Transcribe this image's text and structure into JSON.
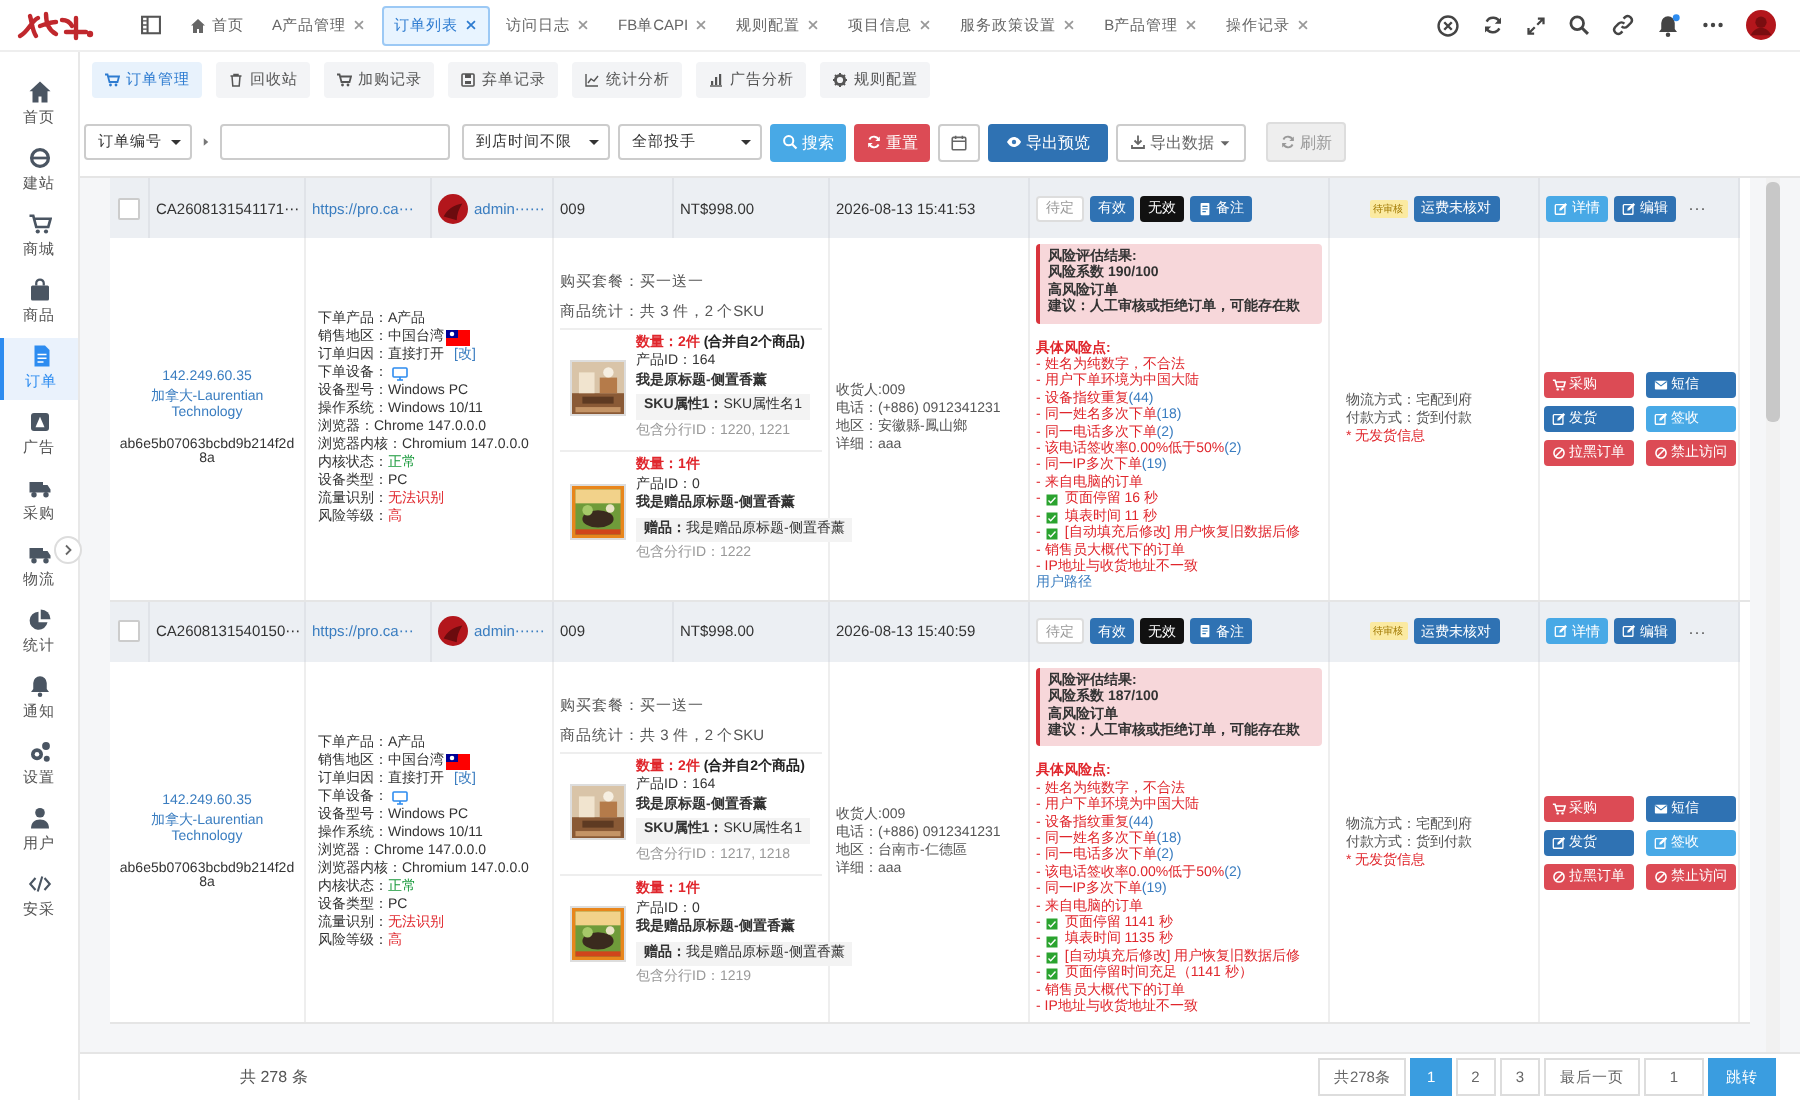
{
  "sidebar": {
    "items": [
      {
        "label": "首页",
        "selected": false
      },
      {
        "label": "建站",
        "selected": false
      },
      {
        "label": "商城",
        "selected": false
      },
      {
        "label": "商品",
        "selected": false
      },
      {
        "label": "订单",
        "selected": true
      },
      {
        "label": "广告",
        "selected": false
      },
      {
        "label": "采购",
        "selected": false
      },
      {
        "label": "物流",
        "selected": false
      },
      {
        "label": "统计",
        "selected": false
      },
      {
        "label": "通知",
        "selected": false
      },
      {
        "label": "设置",
        "selected": false
      },
      {
        "label": "用户",
        "selected": false
      },
      {
        "label": "安采",
        "selected": false
      }
    ]
  },
  "tabs": [
    {
      "label": "首页",
      "kind": "home",
      "selected": false
    },
    {
      "label": "A产品管理",
      "kind": "page",
      "selected": false
    },
    {
      "label": "订单列表",
      "kind": "page",
      "selected": true
    },
    {
      "label": "访问日志",
      "kind": "page",
      "selected": false
    },
    {
      "label": "FB单CAPI",
      "kind": "page",
      "selected": false
    },
    {
      "label": "规则配置",
      "kind": "page",
      "selected": false
    },
    {
      "label": "项目信息",
      "kind": "page",
      "selected": false
    },
    {
      "label": "服务政策设置",
      "kind": "page",
      "selected": false
    },
    {
      "label": "B产品管理",
      "kind": "page",
      "selected": false
    },
    {
      "label": "操作记录",
      "kind": "page",
      "selected": false
    }
  ],
  "toolbar": [
    {
      "label": "订单管理",
      "selected": true
    },
    {
      "label": "回收站",
      "selected": false
    },
    {
      "label": "加购记录",
      "selected": false
    },
    {
      "label": "弃单记录",
      "selected": false
    },
    {
      "label": "统计分析",
      "selected": false
    },
    {
      "label": "广告分析",
      "selected": false
    },
    {
      "label": "规则配置",
      "selected": false
    }
  ],
  "filters": {
    "field_select": "订单编号",
    "time_select": "到店时间不限",
    "pitcher_select": "全部投手",
    "search_button": "搜索",
    "reset_button": "重置",
    "preview_button": "导出预览",
    "export_button": "导出数据",
    "refresh_button": "刷新"
  },
  "orders": [
    {
      "checked": false,
      "order_no": "CA2608131541171⋯",
      "link": "https://pro.ca⋯",
      "user": "admin⋯⋯",
      "code": "009",
      "price": "NT$998.00",
      "time": "2026-08-13 15:41:53",
      "status_buttons": [
        {
          "label": "待定",
          "kind": "pending"
        },
        {
          "label": "有效",
          "kind": "valid"
        },
        {
          "label": "无效",
          "kind": "invalid"
        },
        {
          "label": "备注",
          "kind": "note"
        }
      ],
      "badge": "待审核",
      "freight": "运费未核对",
      "row_actions": [
        {
          "label": "详情",
          "kind": "info"
        },
        {
          "label": "编辑",
          "kind": "primary"
        }
      ],
      "more": "···",
      "ip": "142.249.60.35",
      "isp": "加拿大-Laurentian Technology",
      "fingerprint": "ab6e5b07063bcbd9b214f2d8a",
      "info": [
        {
          "kind": "text",
          "label": "下单产品：",
          "value": "A产品"
        },
        {
          "kind": "flag",
          "label": "销售地区：",
          "value": "中国台湾"
        },
        {
          "kind": "link",
          "label": "订单归因：",
          "value": "直接打开",
          "link": "[改]"
        },
        {
          "kind": "device",
          "label": "下单设备："
        },
        {
          "kind": "text",
          "label": "设备型号：",
          "value": "Windows PC"
        },
        {
          "kind": "text",
          "label": "操作系统：",
          "value": "Windows 10/11"
        },
        {
          "kind": "text",
          "label": "浏览器：",
          "value": "Chrome 147.0.0.0"
        },
        {
          "kind": "text",
          "label": "浏览器内核：",
          "value": "Chromium 147.0.0.0"
        },
        {
          "kind": "good",
          "label": "内核状态：",
          "value": "正常"
        },
        {
          "kind": "text",
          "label": "设备类型：",
          "value": "PC"
        },
        {
          "kind": "bad",
          "label": "流量识别：",
          "value": "无法识别"
        },
        {
          "kind": "bad",
          "label": "风险等级：",
          "value": "高"
        }
      ],
      "package": "购买套餐：买一送一",
      "stats": "商品统计：共 3 件，2 个SKU",
      "items": [
        {
          "qty_label": "数量：",
          "qty": "2件",
          "qty_note": "(合并自2个商品)",
          "product_id": "产品ID：164",
          "title": "我是原标题-侧置香薰",
          "attr_label": "SKU属性1：",
          "attr_value": "SKU属性名1",
          "line_ids": "包含分行ID：1220, 1221"
        },
        {
          "qty_label": "数量：",
          "qty": "1件",
          "product_id": "产品ID：0",
          "title": "我是赠品原标题-侧置香薰",
          "attr_label": "赠品：",
          "attr_value": "我是赠品原标题-侧置香薰",
          "line_ids": "包含分行ID：1222"
        }
      ],
      "receiver": [
        "收货人:009",
        "电话：(+886) 0912341231",
        "地区：安徽縣-鳳山鄉",
        "详细：aaa"
      ],
      "risk_summary": [
        "风险评估结果:",
        "风险系数 190/100",
        "高风险订单",
        "建议：人工审核或拒绝订单，可能存在欺"
      ],
      "risk_title": "具体风险点:",
      "risks": [
        {
          "kind": "plain",
          "text": "- 姓名为纯数字，不合法"
        },
        {
          "kind": "plain",
          "text": "- 用户下单环境为中国大陆"
        },
        {
          "kind": "count",
          "text": "- 设备指纹重复",
          "count": "(44)"
        },
        {
          "kind": "count",
          "text": "- 同一姓名多次下单",
          "count": "(18)"
        },
        {
          "kind": "count",
          "text": "- 同一电话多次下单",
          "count": "(2)"
        },
        {
          "kind": "count",
          "text": "- 该电话签收率0.00%低于50%",
          "count": "(2)"
        },
        {
          "kind": "count",
          "text": "- 同一IP多次下单",
          "count": "(19)"
        },
        {
          "kind": "plain",
          "text": "- 来自电脑的订单"
        },
        {
          "kind": "check",
          "dash": "-",
          "text": "页面停留 16 秒"
        },
        {
          "kind": "check",
          "dash": "-",
          "text": "填表时间 11 秒"
        },
        {
          "kind": "check",
          "dash": "-",
          "text": "[自动填充后修改] 用户恢复旧数据后修"
        },
        {
          "kind": "plain",
          "text": "- 销售员大概代下的订单"
        },
        {
          "kind": "plain",
          "text": "- IP地址与收货地址不一致"
        }
      ],
      "path_link": "用户路径",
      "shipping": [
        "物流方式：宅配到府",
        "付款方式：货到付款"
      ],
      "shipping_warning": "* 无发货信息",
      "actions": [
        {
          "label": "采购",
          "kind": "danger"
        },
        {
          "label": "短信",
          "kind": "primary"
        },
        {
          "label": "发货",
          "kind": "primary"
        },
        {
          "label": "签收",
          "kind": "info"
        },
        {
          "label": "拉黑订单",
          "kind": "danger"
        },
        {
          "label": "禁止访问",
          "kind": "danger"
        }
      ]
    },
    {
      "checked": false,
      "order_no": "CA2608131540150⋯",
      "link": "https://pro.ca⋯",
      "user": "admin⋯⋯",
      "code": "009",
      "price": "NT$998.00",
      "time": "2026-08-13 15:40:59",
      "status_buttons": [
        {
          "label": "待定",
          "kind": "pending"
        },
        {
          "label": "有效",
          "kind": "valid"
        },
        {
          "label": "无效",
          "kind": "invalid"
        },
        {
          "label": "备注",
          "kind": "note"
        }
      ],
      "badge": "待审核",
      "freight": "运费未核对",
      "row_actions": [
        {
          "label": "详情",
          "kind": "info"
        },
        {
          "label": "编辑",
          "kind": "primary"
        }
      ],
      "more": "···",
      "ip": "142.249.60.35",
      "isp": "加拿大-Laurentian Technology",
      "fingerprint": "ab6e5b07063bcbd9b214f2d8a",
      "info": [
        {
          "kind": "text",
          "label": "下单产品：",
          "value": "A产品"
        },
        {
          "kind": "flag",
          "label": "销售地区：",
          "value": "中国台湾"
        },
        {
          "kind": "link",
          "label": "订单归因：",
          "value": "直接打开",
          "link": "[改]"
        },
        {
          "kind": "device",
          "label": "下单设备："
        },
        {
          "kind": "text",
          "label": "设备型号：",
          "value": "Windows PC"
        },
        {
          "kind": "text",
          "label": "操作系统：",
          "value": "Windows 10/11"
        },
        {
          "kind": "text",
          "label": "浏览器：",
          "value": "Chrome 147.0.0.0"
        },
        {
          "kind": "text",
          "label": "浏览器内核：",
          "value": "Chromium 147.0.0.0"
        },
        {
          "kind": "good",
          "label": "内核状态：",
          "value": "正常"
        },
        {
          "kind": "text",
          "label": "设备类型：",
          "value": "PC"
        },
        {
          "kind": "bad",
          "label": "流量识别：",
          "value": "无法识别"
        },
        {
          "kind": "bad",
          "label": "风险等级：",
          "value": "高"
        }
      ],
      "package": "购买套餐：买一送一",
      "stats": "商品统计：共 3 件，2 个SKU",
      "items": [
        {
          "qty_label": "数量：",
          "qty": "2件",
          "qty_note": "(合并自2个商品)",
          "product_id": "产品ID：164",
          "title": "我是原标题-侧置香薰",
          "attr_label": "SKU属性1：",
          "attr_value": "SKU属性名1",
          "line_ids": "包含分行ID：1217, 1218"
        },
        {
          "qty_label": "数量：",
          "qty": "1件",
          "product_id": "产品ID：0",
          "title": "我是赠品原标题-侧置香薰",
          "attr_label": "赠品：",
          "attr_value": "我是赠品原标题-侧置香薰",
          "line_ids": "包含分行ID：1219"
        }
      ],
      "receiver": [
        "收货人:009",
        "电话：(+886) 0912341231",
        "地区：台南市-仁德區",
        "详细：aaa"
      ],
      "risk_summary": [
        "风险评估结果:",
        "风险系数 187/100",
        "高风险订单",
        "建议：人工审核或拒绝订单，可能存在欺"
      ],
      "risk_title": "具体风险点:",
      "risks": [
        {
          "kind": "plain",
          "text": "- 姓名为纯数字，不合法"
        },
        {
          "kind": "plain",
          "text": "- 用户下单环境为中国大陆"
        },
        {
          "kind": "count",
          "text": "- 设备指纹重复",
          "count": "(44)"
        },
        {
          "kind": "count",
          "text": "- 同一姓名多次下单",
          "count": "(18)"
        },
        {
          "kind": "count",
          "text": "- 同一电话多次下单",
          "count": "(2)"
        },
        {
          "kind": "count",
          "text": "- 该电话签收率0.00%低于50%",
          "count": "(2)"
        },
        {
          "kind": "count",
          "text": "- 同一IP多次下单",
          "count": "(19)"
        },
        {
          "kind": "plain",
          "text": "- 来自电脑的订单"
        },
        {
          "kind": "check",
          "dash": "-",
          "text": "页面停留 1141 秒"
        },
        {
          "kind": "check",
          "dash": "-",
          "text": "填表时间 1135 秒"
        },
        {
          "kind": "check",
          "dash": "-",
          "text": "[自动填充后修改] 用户恢复旧数据后修"
        },
        {
          "kind": "check",
          "dash": "-",
          "text": "页面停留时间充足（1141 秒）"
        },
        {
          "kind": "plain",
          "text": "- 销售员大概代下的订单"
        },
        {
          "kind": "plain",
          "text": "- IP地址与收货地址不一致"
        }
      ],
      "shipping": [
        "物流方式：宅配到府",
        "付款方式：货到付款"
      ],
      "shipping_warning": "* 无发货信息",
      "actions": [
        {
          "label": "采购",
          "kind": "danger"
        },
        {
          "label": "短信",
          "kind": "primary"
        },
        {
          "label": "发货",
          "kind": "primary"
        },
        {
          "label": "签收",
          "kind": "info"
        },
        {
          "label": "拉黑订单",
          "kind": "danger"
        },
        {
          "label": "禁止访问",
          "kind": "danger"
        }
      ]
    }
  ],
  "footer": {
    "summary": "共 278 条"
  },
  "pagination": {
    "total": "共278条",
    "pages": [
      {
        "label": "1",
        "selected": true
      },
      {
        "label": "2",
        "selected": false
      },
      {
        "label": "3",
        "selected": false
      }
    ],
    "last": "最后一页",
    "jump_value": "1",
    "jump": "跳转"
  }
}
